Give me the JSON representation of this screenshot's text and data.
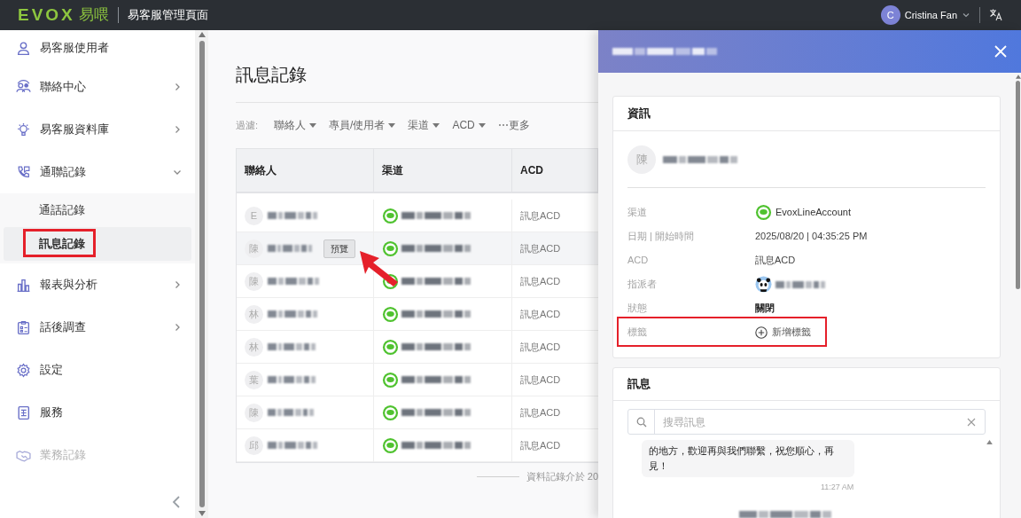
{
  "header": {
    "logo_text": "EVOX",
    "logo_cn": "易喂",
    "title": "易客服管理頁面",
    "user": {
      "initial": "C",
      "name": "Cristina Fan"
    }
  },
  "sidebar": {
    "items": [
      {
        "kind": "user",
        "label": "易客服使用者",
        "disabled": false
      },
      {
        "kind": "contact",
        "label": "聯絡中心",
        "expanded": false,
        "disabled": false
      },
      {
        "kind": "bulb",
        "label": "易客服資料庫",
        "expanded": false,
        "disabled": false
      },
      {
        "kind": "phone",
        "label": "通聯記錄",
        "expanded": true,
        "disabled": false,
        "children": [
          {
            "label": "通話記錄",
            "selected": false,
            "annotated": false
          },
          {
            "label": "訊息記錄",
            "selected": true,
            "annotated": true
          }
        ]
      },
      {
        "kind": "chart",
        "label": "報表與分析",
        "expanded": false,
        "disabled": false
      },
      {
        "kind": "survey",
        "label": "話後調查",
        "expanded": false,
        "disabled": false
      },
      {
        "kind": "gear",
        "label": "設定",
        "disabled": false
      },
      {
        "kind": "service",
        "label": "服務",
        "disabled": false
      },
      {
        "kind": "handshake",
        "label": "業務記錄",
        "disabled": true
      }
    ]
  },
  "main": {
    "title": "訊息記錄",
    "filter_label": "過濾:",
    "filters": [
      "聯絡人",
      "專員/使用者",
      "渠道",
      "ACD"
    ],
    "more": "⋯更多",
    "table": {
      "columns": [
        "聯絡人",
        "渠道",
        "ACD"
      ],
      "rows": [
        {
          "initial": "E",
          "acd": "訊息ACD",
          "hovered": false
        },
        {
          "initial": "陳",
          "acd": "訊息ACD",
          "hovered": true,
          "preview": "預覽",
          "arrow": true
        },
        {
          "initial": "陳",
          "acd": "訊息ACD",
          "hovered": false
        },
        {
          "initial": "林",
          "acd": "訊息ACD",
          "hovered": false
        },
        {
          "initial": "林",
          "acd": "訊息ACD",
          "hovered": false
        },
        {
          "initial": "葉",
          "acd": "訊息ACD",
          "hovered": false
        },
        {
          "initial": "陳",
          "acd": "訊息ACD",
          "hovered": false
        },
        {
          "initial": "邱",
          "acd": "訊息ACD",
          "hovered": false
        }
      ]
    },
    "footer": "資料記錄介於 20"
  },
  "panel": {
    "info": {
      "title": "資訊",
      "contact_initial": "陳",
      "fields": [
        {
          "kind": "channel",
          "label": "渠道",
          "value": "EvoxLineAccount"
        },
        {
          "kind": "text",
          "label": "日期 | 開始時間",
          "value": "2025/08/20 | 04:35:25 PM"
        },
        {
          "kind": "text",
          "label": "ACD",
          "value": "訊息ACD"
        },
        {
          "kind": "agent",
          "label": "指派者"
        },
        {
          "kind": "strong",
          "label": "狀態",
          "value": "關閉"
        },
        {
          "kind": "add",
          "label": "標籤",
          "value": "新增標籤",
          "annotated": true
        }
      ]
    },
    "messages": {
      "title": "訊息",
      "search_placeholder": "搜尋訊息",
      "bubble": "的地方，歡迎再與我們聯繫，祝您順心，再見！",
      "time": "11:27 AM"
    }
  }
}
